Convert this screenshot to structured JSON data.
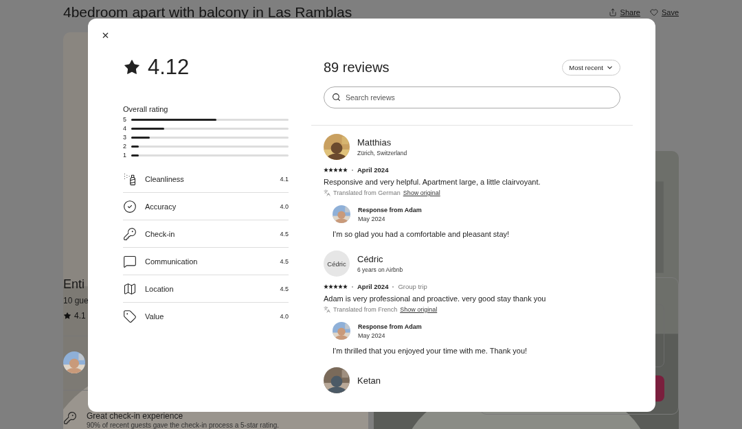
{
  "listing": {
    "title": "4bedroom apart with balcony in Las Ramblas",
    "actions": [
      {
        "kind": "share",
        "label": "Share"
      },
      {
        "kind": "save",
        "label": "Save"
      }
    ],
    "summary": {
      "heading": "Enti",
      "guests": "10 gue",
      "rating": "4.1"
    },
    "highlight": {
      "kind": "checkin",
      "title": "Great check-in experience",
      "description": "90% of recent guests gave the check-in process a 5-star rating."
    }
  },
  "reviews_dialog": {
    "rating": "4.12",
    "overall_label": "Overall rating",
    "distribution": [
      {
        "label": "5",
        "level": 0.54
      },
      {
        "label": "4",
        "level": 0.21
      },
      {
        "label": "3",
        "level": 0.12
      },
      {
        "label": "2",
        "level": 0.05
      },
      {
        "label": "1",
        "level": 0.05
      }
    ],
    "categories": [
      {
        "kind": "cleanliness",
        "label": "Cleanliness",
        "score": "4.1"
      },
      {
        "kind": "accuracy",
        "label": "Accuracy",
        "score": "4.0"
      },
      {
        "kind": "checkin",
        "label": "Check-in",
        "score": "4.5"
      },
      {
        "kind": "communication",
        "label": "Communication",
        "score": "4.5"
      },
      {
        "kind": "location",
        "label": "Location",
        "score": "4.5"
      },
      {
        "kind": "value",
        "label": "Value",
        "score": "4.0"
      }
    ],
    "count": "89 reviews",
    "sort": "Most recent",
    "search": {
      "placeholder": "Search reviews"
    },
    "reviews": [
      {
        "name": "Matthias",
        "subtitle": "Zürich, Switzerland",
        "stars": 5,
        "date": "April 2024",
        "text": "Responsive and very helpful. Apartment large, a little clairvoyant.",
        "translation": {
          "note": "Translated from German",
          "link": "Show original"
        },
        "response": {
          "title": "Response from Adam",
          "date": "May 2024",
          "text": "I'm so glad you had a comfortable and pleasant stay!"
        }
      },
      {
        "name": "Cédric",
        "avatar_alt": "Cédric",
        "subtitle": "6 years on Airbnb",
        "stars": 5,
        "date": "April 2024",
        "trip": "Group trip",
        "text": "Adam is very professional and proactive. very good stay thank you",
        "translation": {
          "note": "Translated from French",
          "link": "Show original"
        },
        "response": {
          "title": "Response from Adam",
          "date": "May 2024",
          "text": "I'm thrilled that you enjoyed your time with me. Thank you!"
        }
      },
      {
        "name": "Ketan"
      }
    ]
  }
}
